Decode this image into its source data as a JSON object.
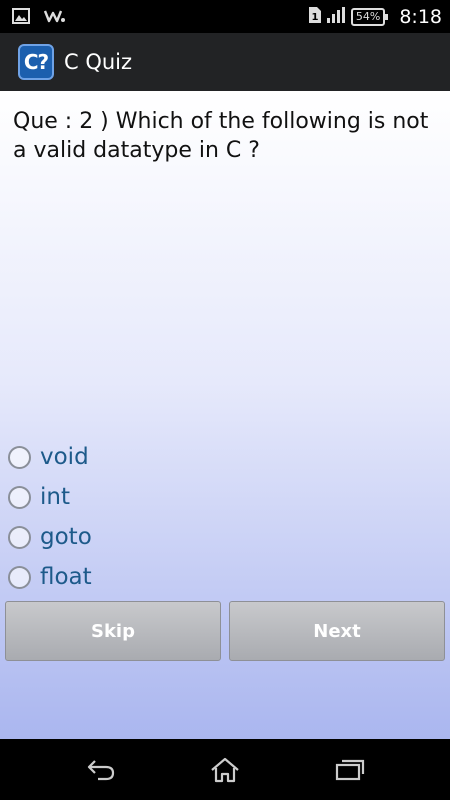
{
  "status_bar": {
    "battery": "54%",
    "time": "8:18",
    "sim": "1",
    "icons": [
      "gallery-icon",
      "walkman-icon",
      "sim-icon",
      "signal-icon",
      "battery-icon"
    ]
  },
  "action_bar": {
    "app_icon_text": "C?",
    "title": "C Quiz"
  },
  "question": {
    "text": "Que : 2 ) Which of the following is not a valid datatype in C ?"
  },
  "options": [
    "void",
    "int",
    "goto",
    "float"
  ],
  "buttons": {
    "skip": "Skip",
    "next": "Next"
  },
  "nav_bar": {
    "icons": [
      "back-icon",
      "home-icon",
      "recents-icon"
    ]
  },
  "colors": {
    "option_text": "#1d5a8a",
    "action_bar": "#222325",
    "app_icon": "#1c5fae",
    "gradient_bottom": "#aab6ef"
  }
}
